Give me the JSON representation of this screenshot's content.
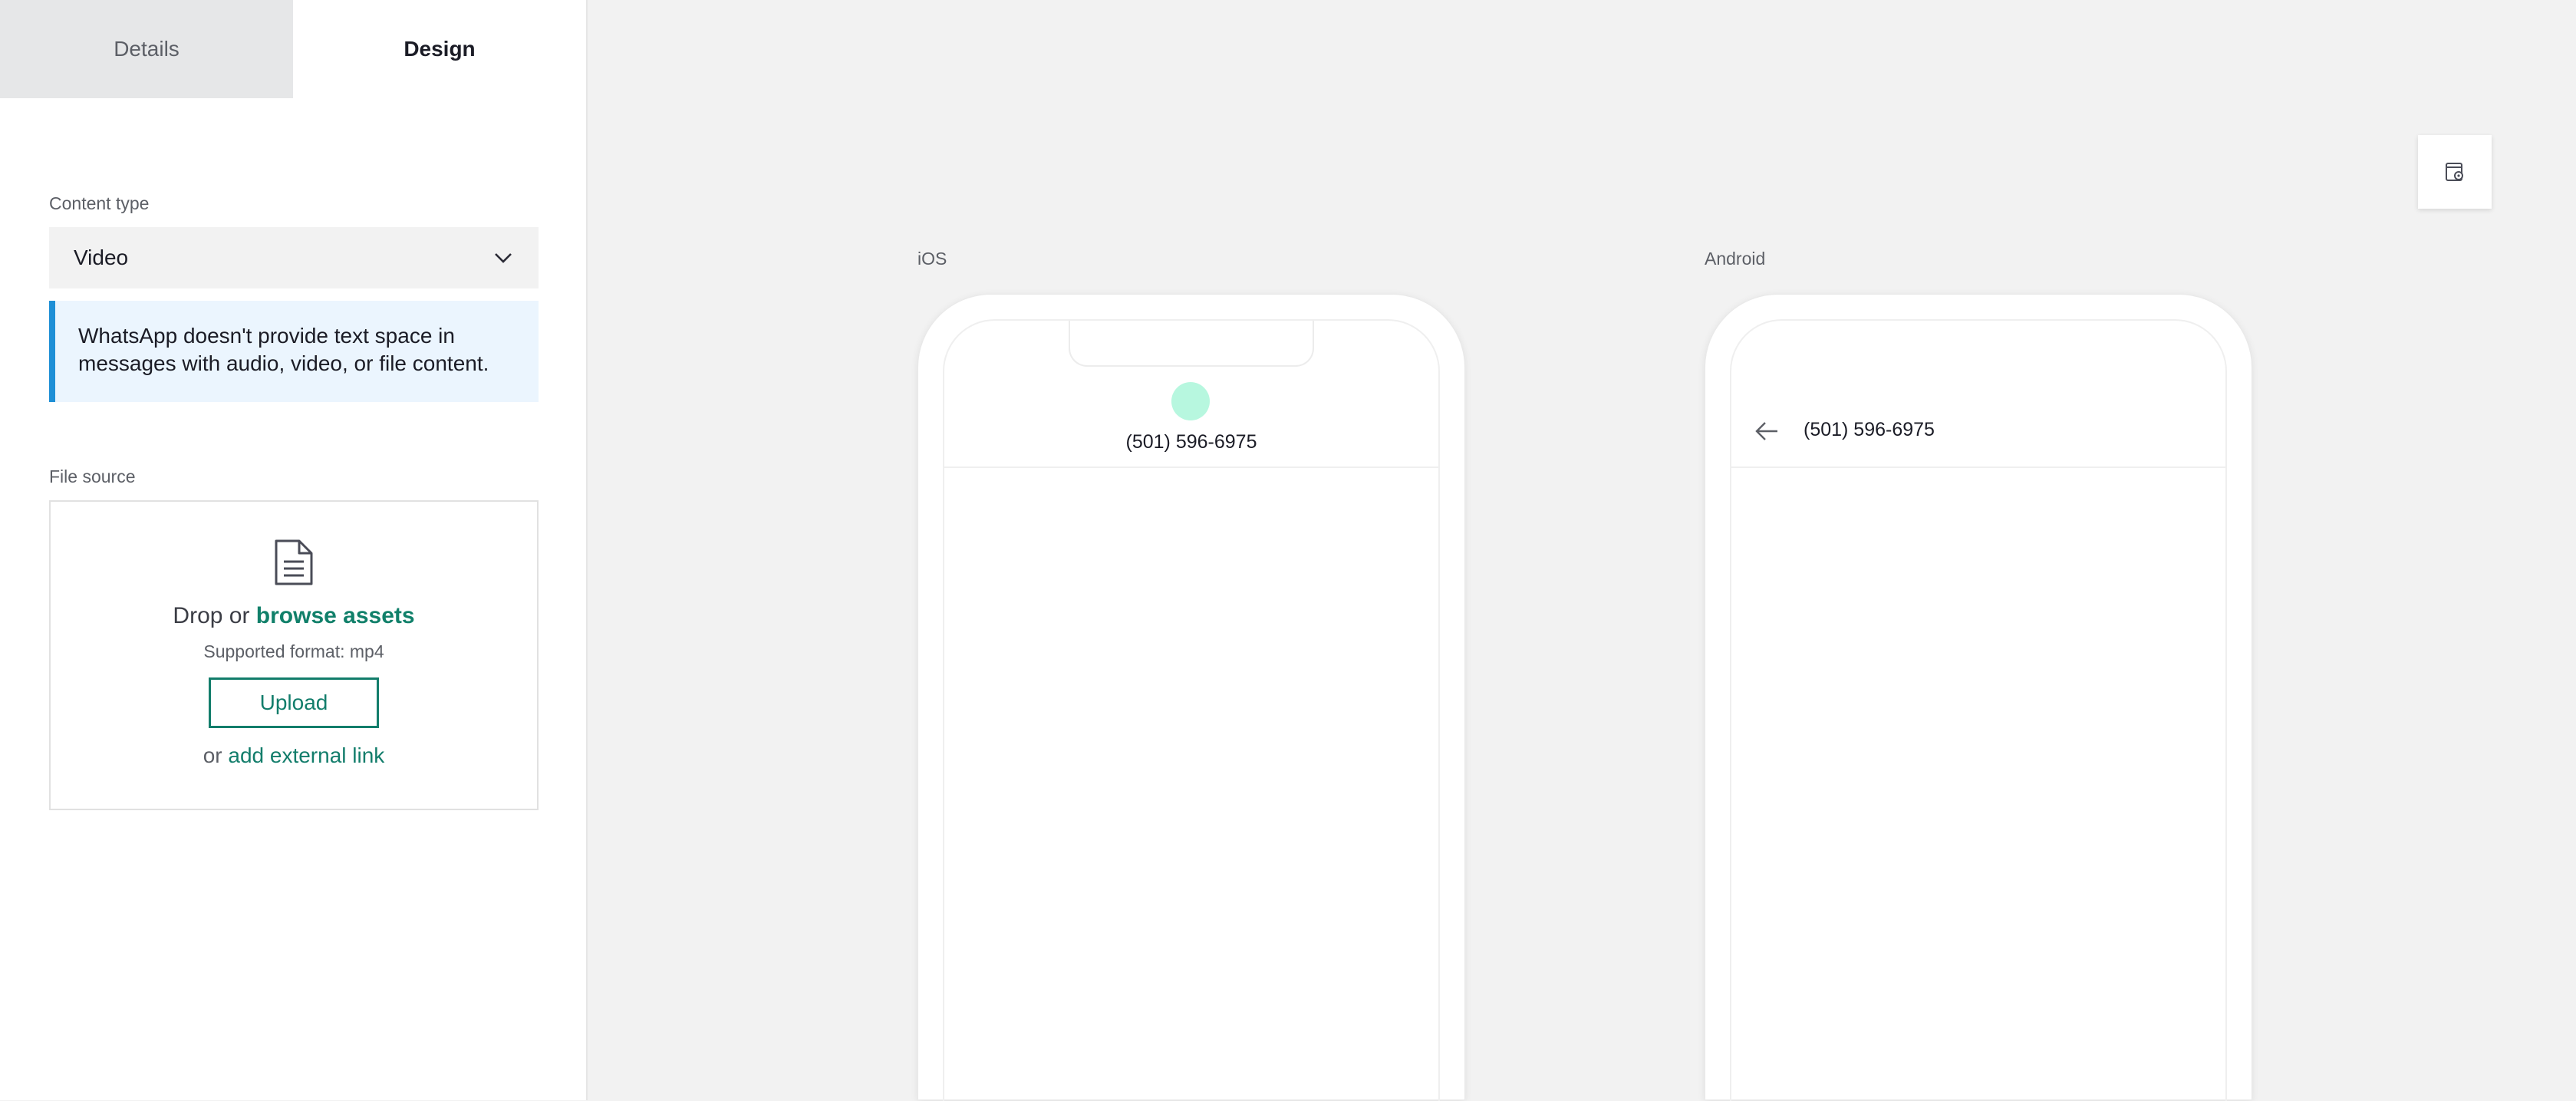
{
  "tabs": [
    {
      "label": "Details",
      "active": false
    },
    {
      "label": "Design",
      "active": true
    }
  ],
  "content_type": {
    "label": "Content type",
    "selected": "Video",
    "icon": "chevron-down-icon"
  },
  "notice": {
    "text": "WhatsApp doesn't provide text space in messages with audio, video, or file content.",
    "accent_color": "#1e8fd6"
  },
  "file_source": {
    "label": "File source",
    "icon": "document-icon",
    "drop_prefix": "Drop or ",
    "browse_link": "browse assets",
    "format": "Supported format: mp4",
    "upload_label": "Upload",
    "external_prefix": "or ",
    "external_link": "add external link",
    "accent_color": "#127d6b"
  },
  "toolbar": {
    "settings_icon": "preview-settings-icon"
  },
  "preview": {
    "ios": {
      "label": "iOS",
      "phone_number": "(501) 596-6975",
      "avatar_color": "#b7f7df"
    },
    "android": {
      "label": "Android",
      "phone_number": "(501) 596-6975",
      "back_icon": "arrow-left-icon"
    }
  }
}
